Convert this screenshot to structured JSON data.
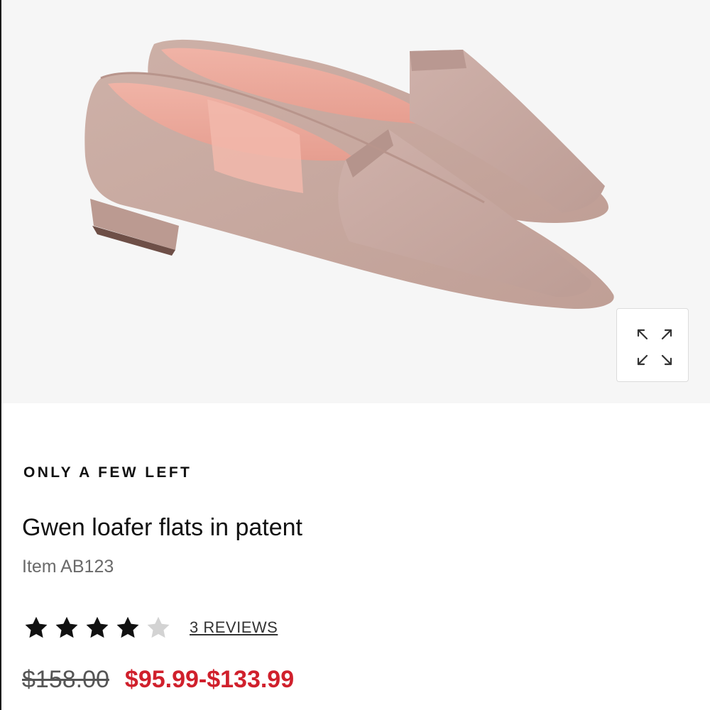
{
  "product": {
    "stock_status": "ONLY A FEW LEFT",
    "title": "Gwen loafer flats in patent",
    "item_number": "Item AB123",
    "rating": {
      "value": 4,
      "max": 5,
      "reviews_label": "3 REVIEWS"
    },
    "price": {
      "original": "$158.00",
      "sale": "$95.99-$133.99"
    }
  },
  "gallery": {
    "image_subject": "pair of blush suede pointed-toe loafer flats",
    "expand_icon": "expand-arrows-icon"
  },
  "colors": {
    "sale_price": "#d0202c",
    "star_filled": "#111111",
    "star_empty": "#d3d3d3",
    "hero_background": "#f6f6f6",
    "suede": "#c8a9a0",
    "patent_vamp": "#c9aaa3",
    "lining": "#eeaa9e"
  }
}
